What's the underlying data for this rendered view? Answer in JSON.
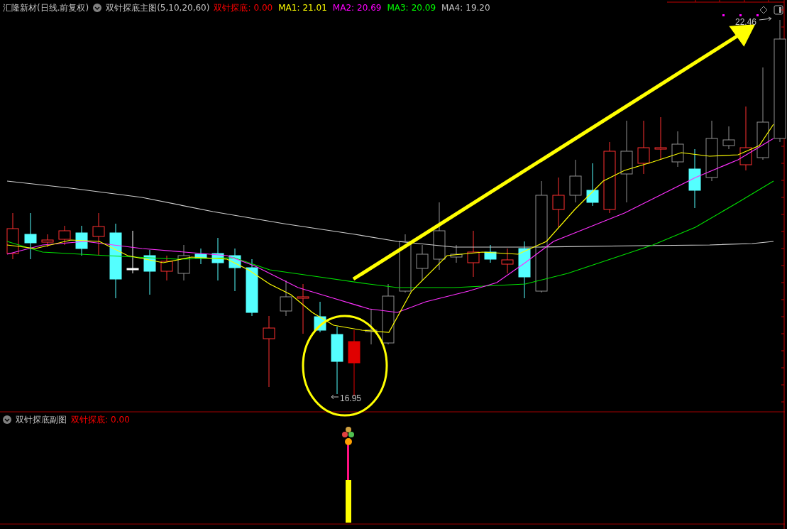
{
  "main_chart": {
    "title": "汇隆新材(日线.前复权)",
    "indicator": "双针探底主图(5,10,20,60)",
    "readouts": [
      {
        "label": "双针探底:",
        "value": "0.00",
        "color": "#ff0000"
      },
      {
        "label": "MA1:",
        "value": "21.01",
        "color": "#ffff00"
      },
      {
        "label": "MA2:",
        "value": "20.69",
        "color": "#ff00ff"
      },
      {
        "label": "MA3:",
        "value": "20.09",
        "color": "#00ff00"
      },
      {
        "label": "MA4:",
        "value": "19.20",
        "color": "#c0c0c0"
      }
    ],
    "high_label": "22.46",
    "low_label": "16.95"
  },
  "sub_chart": {
    "indicator": "双针探底副图",
    "readouts": [
      {
        "label": "双针探底:",
        "value": "0.00",
        "color": "#ff0000"
      }
    ]
  }
}
